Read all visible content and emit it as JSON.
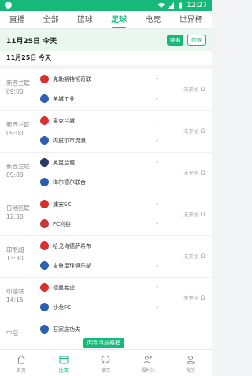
{
  "status": {
    "time": "12:27"
  },
  "tabs": [
    {
      "label": "直播",
      "active": false
    },
    {
      "label": "全部",
      "active": false
    },
    {
      "label": "篮球",
      "active": false
    },
    {
      "label": "足球",
      "active": true
    },
    {
      "label": "电竞",
      "active": false
    },
    {
      "label": "世界杯",
      "active": false
    }
  ],
  "date_header": {
    "title": "11月25日 今天",
    "filter_btn": "赛事",
    "filter_btn2": "筛赛"
  },
  "date_sub": "11月25日 今天",
  "matches": [
    {
      "league": "新西兰联",
      "time": "09:00",
      "home": "克勒斯特彻奇联",
      "away": "羊城工业",
      "home_score": "-",
      "away_score": "-",
      "state": "未开始",
      "home_color": "#d9302e",
      "away_color": "#2b5fb4"
    },
    {
      "league": "新西兰联",
      "time": "09:00",
      "home": "奥克兰城",
      "away": "内皮尔市流浪",
      "home_score": "-",
      "away_score": "-",
      "state": "未开始",
      "home_color": "#d9302e",
      "away_color": "#2b5fb4"
    },
    {
      "league": "新西兰联",
      "time": "09:00",
      "home": "奥克兰城",
      "away": "梅尔德尔联合",
      "home_score": "-",
      "away_score": "-",
      "state": "未开始",
      "home_color": "#2a3a66",
      "away_color": "#2b5fb4"
    },
    {
      "league": "日地区联",
      "time": "12:30",
      "home": "浦安SC",
      "away": "FC刈谷",
      "home_score": "-",
      "away_score": "-",
      "state": "未开始",
      "home_color": "#d9302e",
      "away_color": "#c9363a"
    },
    {
      "league": "印尼超",
      "time": "13:30",
      "home": "哈戈肯德萨希布",
      "away": "吉鲁足球俱乐部",
      "home_score": "-",
      "away_score": "-",
      "state": "未开始",
      "home_color": "#d9302e",
      "away_color": "#2b5fb4"
    },
    {
      "league": "印德联",
      "time": "14:15",
      "home": "德里老虎",
      "away": "沙龙FC",
      "home_score": "-",
      "away_score": "-",
      "state": "未开始",
      "home_color": "#d9302e",
      "away_color": "#2b5fb4"
    },
    {
      "league": "中冠",
      "time": "",
      "home": "石家庄功夫",
      "away": "",
      "home_score": "",
      "away_score": "",
      "state": "",
      "home_color": "#2b5fb4",
      "away_color": "#ffffff"
    }
  ],
  "float_btn": "回到当前赛程",
  "bottom_nav": [
    {
      "label": "首页",
      "icon": "home-icon",
      "active": false
    },
    {
      "label": "比赛",
      "icon": "calendar-icon",
      "active": true
    },
    {
      "label": "聊天",
      "icon": "chat-icon",
      "active": false
    },
    {
      "label": "福利社",
      "icon": "friends-icon",
      "active": false
    },
    {
      "label": "我的",
      "icon": "profile-icon",
      "active": false
    }
  ],
  "colors": {
    "accent": "#16b97a"
  }
}
